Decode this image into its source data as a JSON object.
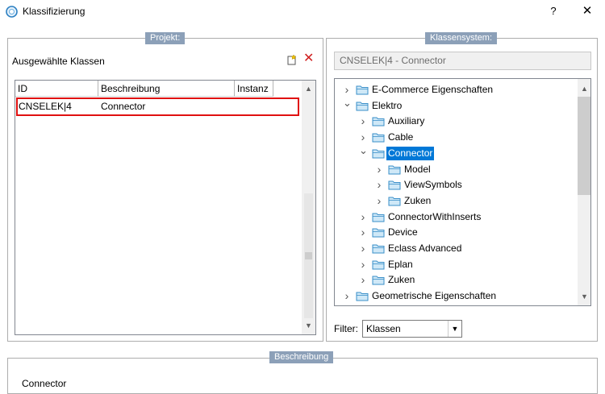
{
  "window": {
    "title": "Klassifizierung",
    "help_label": "?",
    "close_label": "✕"
  },
  "projekt": {
    "legend": "Projekt:",
    "section_label": "Ausgewählte Klassen",
    "delete_glyph": "✕",
    "table": {
      "columns": [
        "ID",
        "Beschreibung",
        "Instanz"
      ],
      "rows": [
        {
          "id": "CNSELEK|4",
          "beschreibung": "Connector",
          "instanz": ""
        }
      ]
    }
  },
  "klassensystem": {
    "legend": "Klassensystem:",
    "path": "CNSELEK|4 - Connector",
    "tree": [
      {
        "label": "E-Commerce Eigenschaften",
        "level": 0,
        "expanded": false,
        "selected": false
      },
      {
        "label": "Elektro",
        "level": 0,
        "expanded": true,
        "selected": false
      },
      {
        "label": "Auxiliary",
        "level": 1,
        "expanded": false,
        "selected": false
      },
      {
        "label": "Cable",
        "level": 1,
        "expanded": false,
        "selected": false
      },
      {
        "label": "Connector",
        "level": 1,
        "expanded": true,
        "selected": true
      },
      {
        "label": "Model",
        "level": 2,
        "expanded": false,
        "selected": false
      },
      {
        "label": "ViewSymbols",
        "level": 2,
        "expanded": false,
        "selected": false
      },
      {
        "label": "Zuken",
        "level": 2,
        "expanded": false,
        "selected": false
      },
      {
        "label": "ConnectorWithInserts",
        "level": 1,
        "expanded": false,
        "selected": false
      },
      {
        "label": "Device",
        "level": 1,
        "expanded": false,
        "selected": false
      },
      {
        "label": "Eclass Advanced",
        "level": 1,
        "expanded": false,
        "selected": false
      },
      {
        "label": "Eplan",
        "level": 1,
        "expanded": false,
        "selected": false
      },
      {
        "label": "Zuken",
        "level": 1,
        "expanded": false,
        "selected": false
      },
      {
        "label": "Geometrische Eigenschaften",
        "level": 0,
        "expanded": false,
        "selected": false
      }
    ],
    "filter": {
      "label": "Filter:",
      "selected": "Klassen"
    }
  },
  "beschreibung": {
    "legend": "Beschreibung",
    "text": "Connector"
  },
  "colors": {
    "legend_bg": "#8ca0b8",
    "selection_bg": "#0078d7",
    "highlight_border": "#e01010",
    "folder_fill": "#cfe8f7",
    "folder_stroke": "#3a8fc9"
  },
  "icons": {
    "app": "app-circle-icon",
    "new": "new-document-icon",
    "delete": "delete-x-icon",
    "folder": "folder-icon",
    "twisty_collapsed": "chevron-right-icon",
    "twisty_expanded": "chevron-down-icon"
  }
}
